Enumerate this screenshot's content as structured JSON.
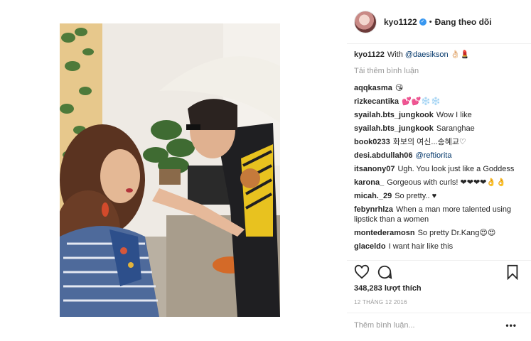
{
  "post": {
    "username": "kyo1122",
    "separator": "•",
    "follow_state": "Đang theo dõi"
  },
  "caption": {
    "username": "kyo1122",
    "text": "With",
    "mention": "@daesikson",
    "emoji": "👌🏻💄"
  },
  "load_more": "Tải thêm bình luận",
  "comments": [
    {
      "user": "aqqkasma",
      "text": "😘"
    },
    {
      "user": "rizkecantika",
      "text": "💕💕❄️❄️"
    },
    {
      "user": "syailah.bts_jungkook",
      "text": "Wow I like"
    },
    {
      "user": "syailah.bts_jungkook",
      "text": "Saranghae"
    },
    {
      "user": "book0233",
      "text": "화보의 여신...송혜교♡"
    },
    {
      "user": "desi.abdullah06",
      "text": "@reftiorita"
    },
    {
      "user": "itsanony07",
      "text": "Ugh. You look just like a Goddess"
    },
    {
      "user": "karona_",
      "text": "Gorgeous with curls! ❤❤❤❤👌👌"
    },
    {
      "user": "micah._29",
      "text": "So pretty.. ♥"
    },
    {
      "user": "febynrhlza",
      "text": "When a man more talented using lipstick than a women"
    },
    {
      "user": "montederamosn",
      "text": "So pretty Dr.Kang😍😍"
    },
    {
      "user": "glaceldo",
      "text": "I want hair like this"
    }
  ],
  "likes": "348,283 lượt thích",
  "date": "12 THÁNG 12 2016",
  "add_comment_placeholder": "Thêm bình luận...",
  "more_label": "•••",
  "icons": {
    "verified": "verified-badge-icon",
    "like": "heart-icon",
    "comment": "comment-bubble-icon",
    "save": "bookmark-icon",
    "more": "ellipsis-icon"
  },
  "colors": {
    "text": "#262626",
    "muted": "#999999",
    "mention": "#003569",
    "verified": "#3897f0"
  }
}
